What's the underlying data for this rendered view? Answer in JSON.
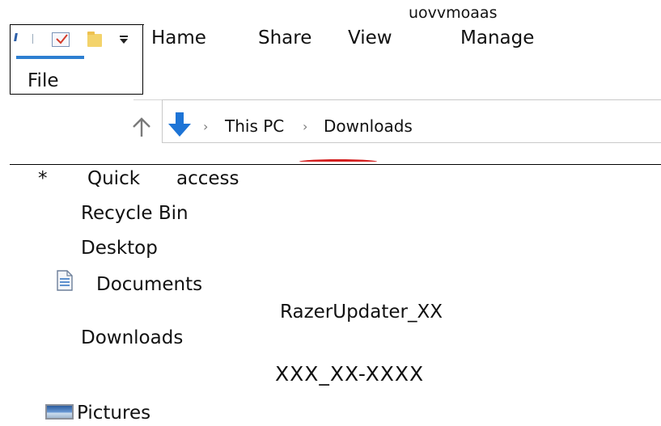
{
  "ribbon": {
    "tabs": {
      "file": "File",
      "home": "Hame",
      "share": "Share",
      "view": "View",
      "manage": "Manage"
    },
    "context_title": "uovvmoaas"
  },
  "address_bar": {
    "crumb_1": "This PC",
    "crumb_2": "Downloads"
  },
  "nav_pane": {
    "quick_access_mark": "*",
    "quick_access_word_1": "Quick",
    "quick_access_word_2": "access",
    "recycle_bin": "Recycle Bin",
    "desktop": "Desktop",
    "documents": "Documents",
    "downloads": "Downloads",
    "pictures": "Pictures"
  },
  "content": {
    "item_1": "RazerUpdater_XX",
    "item_2": "XXX_XX-XXXX"
  },
  "icons": {
    "qat": [
      "properties-icon",
      "checkbox-icon",
      "new-folder-icon",
      "customize-dropdown-icon"
    ],
    "address": [
      "up-arrow-icon",
      "downloads-arrow-icon"
    ],
    "nav": [
      "documents-icon",
      "pictures-icon"
    ]
  },
  "colors": {
    "accent_blue": "#2d7fd1",
    "divider": "#000000",
    "alert_red": "#d42020"
  }
}
